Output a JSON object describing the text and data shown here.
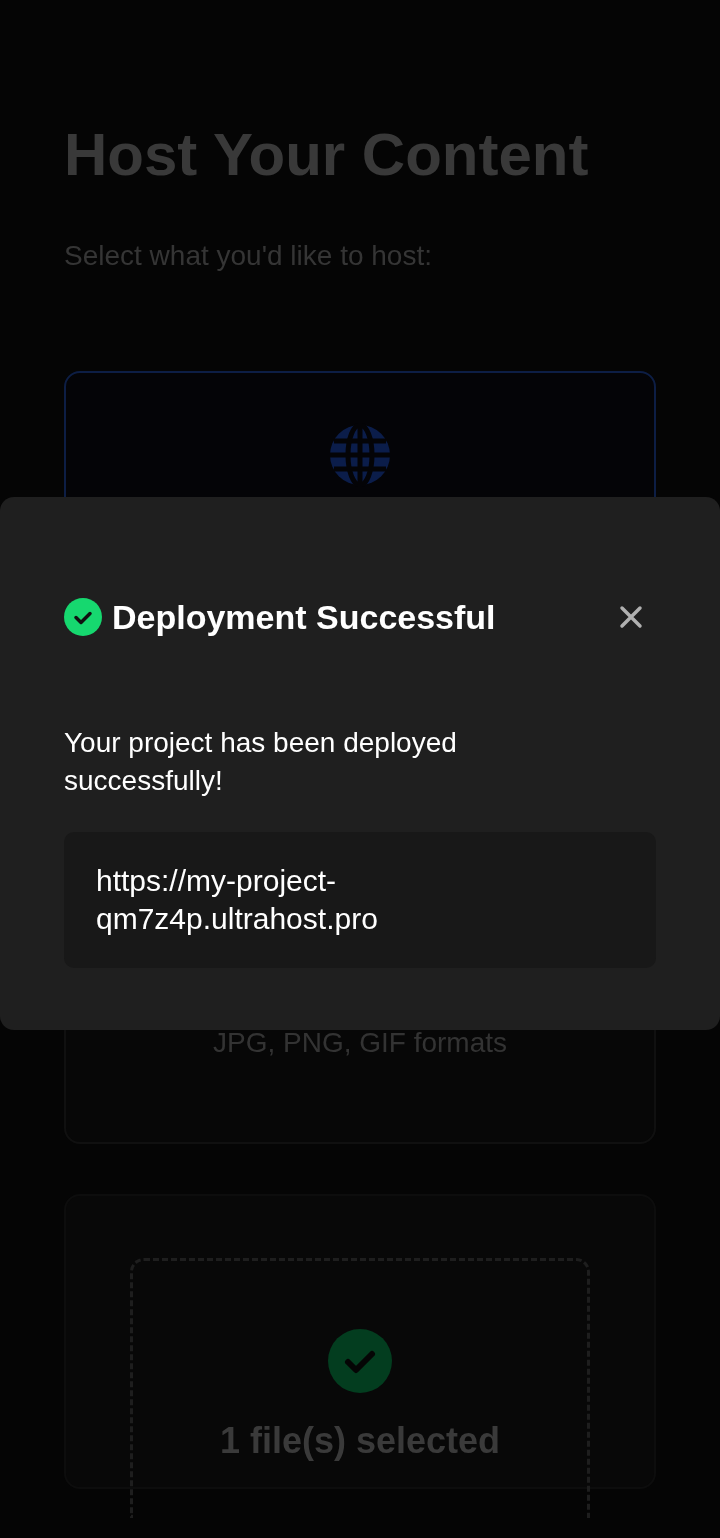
{
  "page": {
    "title": "Host Your Content",
    "subtitle": "Select what you'd like to host:"
  },
  "options": [
    {
      "kind": "website",
      "selected": true
    },
    {
      "kind": "image",
      "selected": false,
      "note": "JPG, PNG, GIF formats"
    }
  ],
  "upload": {
    "has_file": true,
    "status": "1 file(s) selected"
  },
  "modal": {
    "succeeded": true,
    "title": "Deployment Successful",
    "message": "Your project has been deployed successfully!",
    "url": "https://my-project-qm7z4p.ultrahost.pro"
  }
}
